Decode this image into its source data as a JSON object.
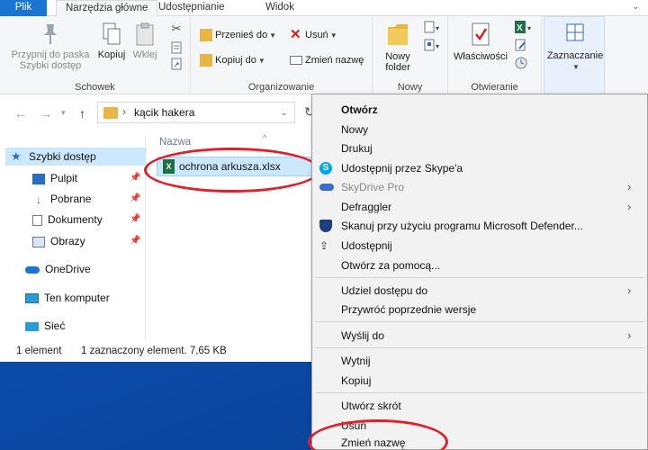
{
  "ribbon": {
    "tabs": [
      "Plik",
      "Narzędzia główne",
      "Udostępnianie",
      "Widok"
    ],
    "pin_label": "Przypnij do paska Szybki dostęp",
    "copy_label": "Kopiuj",
    "paste_label": "Wklej",
    "clipboard_group": "Schowek",
    "move_to_label": "Przenieś do",
    "copy_to_label": "Kopiuj do",
    "delete_label": "Usuń",
    "rename_label": "Zmień nazwę",
    "organize_group": "Organizowanie",
    "new_folder_label": "Nowy folder",
    "new_group": "Nowy",
    "properties_label": "Właściwości",
    "open_group": "Otwieranie",
    "select_label": "Zaznaczanie"
  },
  "address": {
    "path": "kącik hakera"
  },
  "nav": {
    "quick_access": "Szybki dostęp",
    "desktop": "Pulpit",
    "downloads": "Pobrane",
    "documents": "Dokumenty",
    "pictures": "Obrazy",
    "onedrive": "OneDrive",
    "this_pc": "Ten komputer",
    "network": "Sieć"
  },
  "files": {
    "column_name": "Nazwa",
    "items": [
      {
        "name": "ochrona arkusza.xlsx",
        "icon": "excel-file-icon"
      }
    ]
  },
  "status": {
    "count": "1 element",
    "selection": "1 zaznaczony element. 7,65 KB"
  },
  "context_menu": {
    "open": "Otwórz",
    "new": "Nowy",
    "print": "Drukuj",
    "share_skype": "Udostępnij przez Skype'a",
    "skydrive": "SkyDrive Pro",
    "defraggler": "Defraggler",
    "defender": "Skanuj przy użyciu programu Microsoft Defender...",
    "share": "Udostępnij",
    "open_with": "Otwórz za pomocą...",
    "give_access": "Udziel dostępu do",
    "restore": "Przywróć poprzednie wersje",
    "send_to": "Wyślij do",
    "cut": "Wytnij",
    "copy": "Kopiuj",
    "create_shortcut": "Utwórz skrót",
    "delete": "Usuń",
    "rename": "Zmień nazwę"
  },
  "colors": {
    "accent": "#1a74d2",
    "selection": "#cce8ff",
    "annotation": "#e0202a",
    "excel": "#1d7145"
  }
}
